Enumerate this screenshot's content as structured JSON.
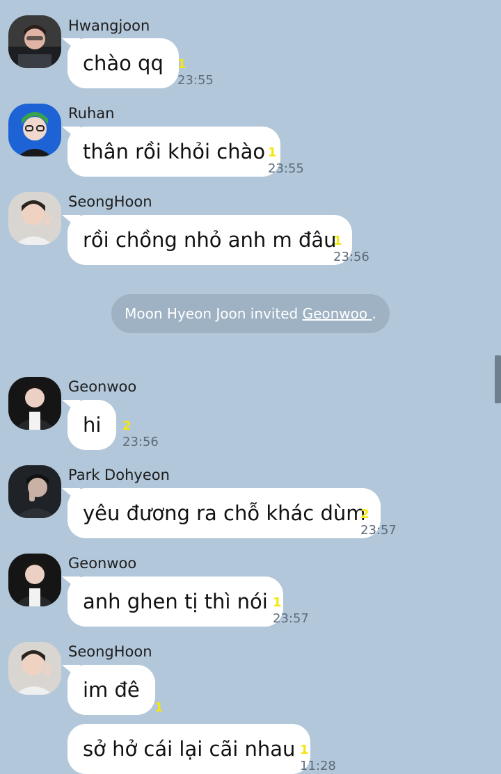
{
  "colors": {
    "background": "#b2c7da",
    "bubble": "#ffffff",
    "unread": "#f4e60f",
    "timestamp": "#5d6b78",
    "system_pill": "#9fb2c4"
  },
  "messages": [
    {
      "sender": "Hwangjoon",
      "avatar": "avatar-hwangjoon",
      "text": "chào qq",
      "unread": "1",
      "time": "23:55"
    },
    {
      "sender": "Ruhan",
      "avatar": "avatar-ruhan",
      "text": "thân rồi khỏi chào",
      "unread": "1",
      "time": "23:55"
    },
    {
      "sender": "SeongHoon",
      "avatar": "avatar-seonghoon",
      "text": "rồi chồng nhỏ anh m đâu",
      "unread": "1",
      "time": "23:56"
    },
    {
      "sender": "Geonwoo",
      "avatar": "avatar-geonwoo",
      "text": "hi",
      "unread": "2",
      "time": "23:56"
    },
    {
      "sender": "Park Dohyeon",
      "avatar": "avatar-park-dohyeon",
      "text": "yêu đương ra chỗ khác dùm",
      "unread": "2",
      "time": "23:57"
    },
    {
      "sender": "Geonwoo",
      "avatar": "avatar-geonwoo",
      "text": "anh ghen tị thì nói",
      "unread": "1",
      "time": "23:57"
    },
    {
      "sender": "SeongHoon",
      "avatar": "avatar-seonghoon",
      "text": "im đê",
      "unread": "1",
      "time": ""
    },
    {
      "sender": "",
      "avatar": "",
      "text": "sở hở cái lại cãi nhau",
      "unread": "1",
      "time": "11:28"
    }
  ],
  "system_message": {
    "prefix": "Moon Hyeon Joon invited ",
    "link": "Geonwoo ",
    "suffix": "."
  }
}
